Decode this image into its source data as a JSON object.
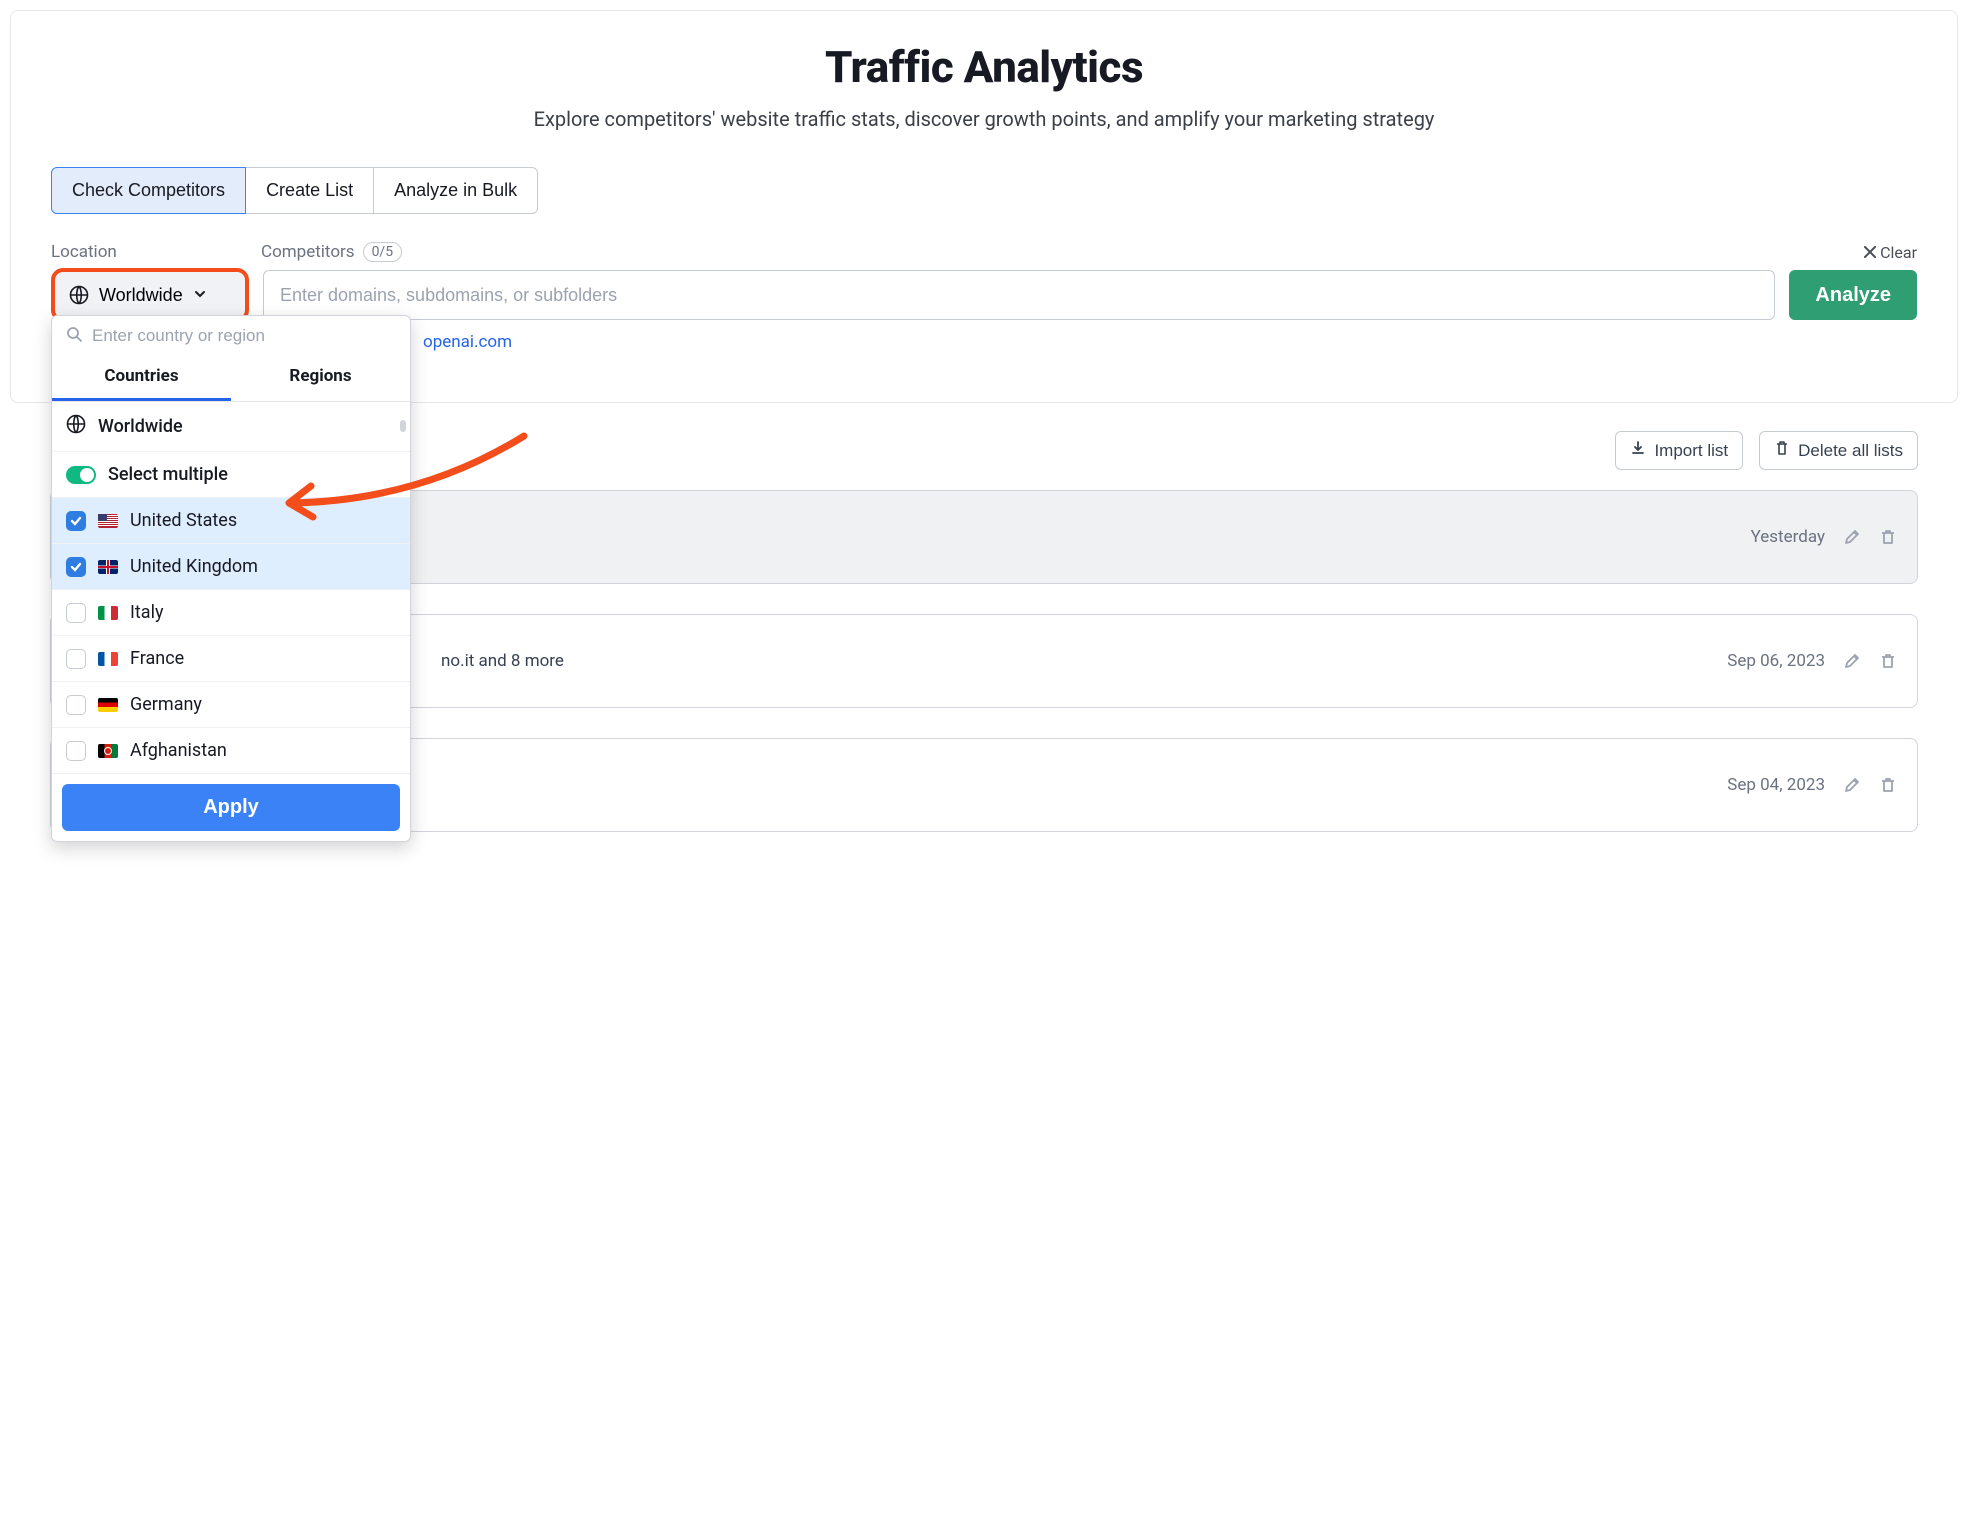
{
  "header": {
    "title": "Traffic Analytics",
    "subtitle": "Explore competitors' website traffic stats, discover growth points, and amplify your marketing strategy"
  },
  "tabs": {
    "check": "Check Competitors",
    "create": "Create List",
    "bulk": "Analyze in Bulk"
  },
  "labels": {
    "location": "Location",
    "competitors": "Competitors",
    "competitors_count": "0/5",
    "clear": "Clear"
  },
  "location_btn": "Worldwide",
  "domain_placeholder": "Enter domains, subdomains, or subfolders",
  "analyze": "Analyze",
  "link": "openai.com",
  "dropdown": {
    "search_placeholder": "Enter country or region",
    "tab_countries": "Countries",
    "tab_regions": "Regions",
    "worldwide": "Worldwide",
    "select_multiple": "Select multiple",
    "countries": {
      "us": "United States",
      "uk": "United Kingdom",
      "it": "Italy",
      "fr": "France",
      "de": "Germany",
      "af": "Afghanistan"
    },
    "apply": "Apply"
  },
  "buttons": {
    "import": "Import list",
    "delete_all": "Delete all lists"
  },
  "cards": {
    "c1": {
      "time": "Yesterday"
    },
    "c2": {
      "extra": "no.it and 8 more",
      "time": "Sep 06, 2023"
    },
    "c3": {
      "time": "Sep 04, 2023"
    }
  }
}
